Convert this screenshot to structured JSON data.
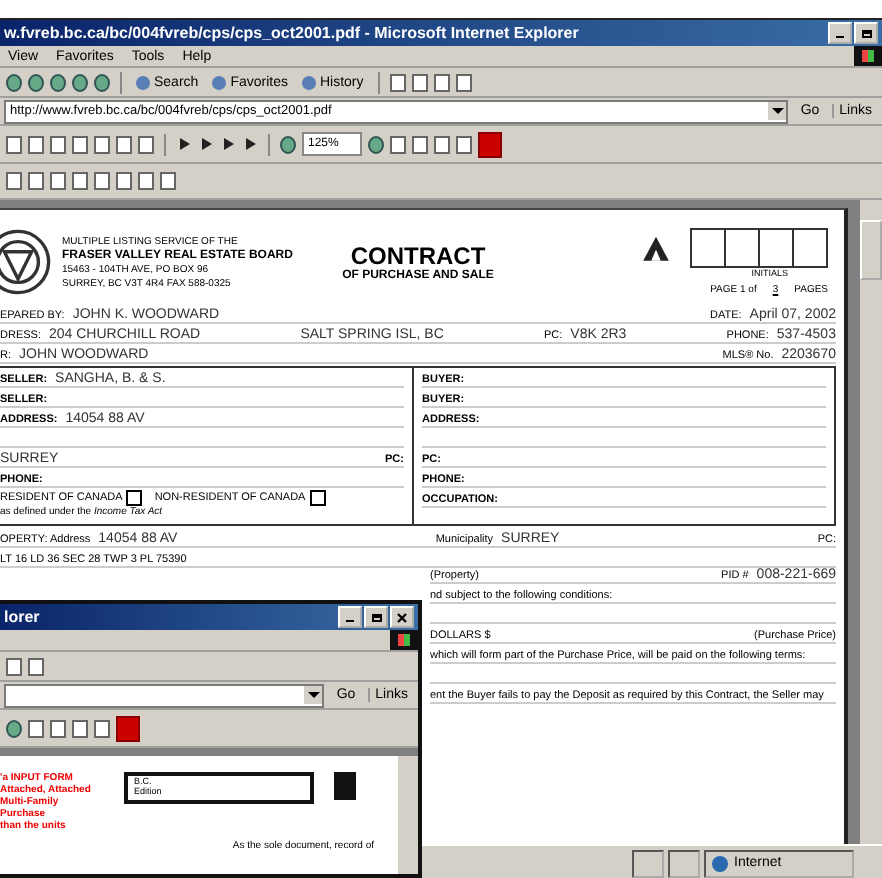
{
  "window": {
    "title": "w.fvreb.bc.ca/bc/004fvreb/cps/cps_oct2001.pdf - Microsoft Internet Explorer"
  },
  "menu": [
    "View",
    "Favorites",
    "Tools",
    "Help"
  ],
  "toolbar": [
    "Search",
    "Favorites",
    "History"
  ],
  "address": {
    "value": "http://www.fvreb.bc.ca/bc/004fvreb/cps/cps_oct2001.pdf",
    "go": "Go",
    "links": "Links"
  },
  "zoom": "125%",
  "doc": {
    "board": [
      "MULTIPLE LISTING SERVICE OF THE",
      "FRASER VALLEY REAL ESTATE BOARD",
      "15463 - 104TH AVE, PO BOX 96",
      "SURREY, BC V3T 4R4 FAX 588-0325"
    ],
    "title": "CONTRACT",
    "subtitle": "OF PURCHASE AND SALE",
    "initials": "INITIALS",
    "page_prefix": "PAGE 1 of",
    "page_count": "3",
    "page_suffix": "PAGES",
    "header_rows": [
      {
        "fields": [
          {
            "label": "EPARED BY:",
            "value": "JOHN K. WOODWARD"
          },
          {
            "label": "DATE:",
            "value": "April 07, 2002"
          }
        ]
      },
      {
        "fields": [
          {
            "label": "DRESS:",
            "value": "204 CHURCHILL ROAD"
          },
          {
            "value": "SALT SPRING ISL, BC"
          },
          {
            "label": "PC:",
            "value": "V8K 2R3"
          },
          {
            "label": "PHONE:",
            "value": "537-4503"
          }
        ]
      },
      {
        "fields": [
          {
            "label": "R:",
            "value": "JOHN WOODWARD"
          },
          {
            "label": "MLS® No.",
            "value": "2203670"
          }
        ]
      }
    ],
    "seller_rows": [
      {
        "kind": "fields",
        "fields": [
          {
            "label": "SELLER:",
            "value": "SANGHA, B. & S."
          }
        ]
      },
      {
        "kind": "fields",
        "fields": [
          {
            "label": "SELLER:"
          }
        ]
      },
      {
        "kind": "fields",
        "fields": [
          {
            "label": "ADDRESS:",
            "value": "14054 88 AV"
          }
        ]
      },
      {
        "kind": "blank"
      },
      {
        "kind": "fields",
        "fields": [
          {
            "value": "SURREY"
          },
          {
            "label": "PC:"
          }
        ]
      },
      {
        "kind": "fields",
        "fields": [
          {
            "label": "PHONE:"
          }
        ]
      },
      {
        "kind": "residency",
        "options": [
          {
            "label": "RESIDENT OF CANADA",
            "checked": false
          },
          {
            "label": "NON-RESIDENT OF CANADA",
            "checked": false
          }
        ],
        "note": "as defined under the *Income Tax Act*"
      }
    ],
    "buyer_rows": [
      {
        "kind": "fields",
        "fields": [
          {
            "label": "BUYER:"
          }
        ]
      },
      {
        "kind": "fields",
        "fields": [
          {
            "label": "BUYER:"
          }
        ]
      },
      {
        "kind": "fields",
        "fields": [
          {
            "label": "ADDRESS:"
          }
        ]
      },
      {
        "kind": "blank"
      },
      {
        "kind": "fields",
        "fields": [
          {
            "label": "PC:"
          }
        ]
      },
      {
        "kind": "fields",
        "fields": [
          {
            "label": "PHONE:"
          }
        ]
      },
      {
        "kind": "fields",
        "fields": [
          {
            "label": "OCCUPATION:"
          }
        ]
      }
    ],
    "body_rows": [
      {
        "kind": "fields",
        "fields": [
          {
            "label": "OPERTY: Address",
            "value": "14054 88 AV"
          },
          {
            "label": "Municipality",
            "value": "SURREY"
          },
          {
            "label": "PC:"
          }
        ]
      },
      {
        "kind": "text",
        "text": "LT 16 LD 36 SEC 28 TWP 3 PL 75390"
      }
    ],
    "right_rows": [
      {
        "kind": "fields",
        "fields": [
          {
            "label": "(Property)"
          },
          {
            "label": "PID #",
            "value": "008-221-669"
          }
        ]
      },
      {
        "kind": "text",
        "text": "nd subject to the following conditions:"
      },
      {
        "kind": "blank"
      },
      {
        "kind": "fields",
        "fields": [
          {
            "label": "DOLLARS $"
          },
          {
            "label": "(Purchase Price)"
          }
        ]
      },
      {
        "kind": "text",
        "text": "which will form part of the Purchase Price, will be paid on the following terms:"
      },
      {
        "kind": "blank"
      },
      {
        "kind": "text",
        "text": "ent the Buyer fails to pay the Deposit as required by this Contract, the Seller may"
      }
    ]
  },
  "status": "Internet",
  "popup": {
    "title": "lorer",
    "go": "Go",
    "links": "Links",
    "form_lines": [
      "'a INPUT FORM",
      "Attached, Attached",
      "Multi-Family Purchase",
      "than the units"
    ],
    "box_lines": [
      "B.C.",
      "Edition"
    ],
    "footer": "As the sole document, record of"
  }
}
